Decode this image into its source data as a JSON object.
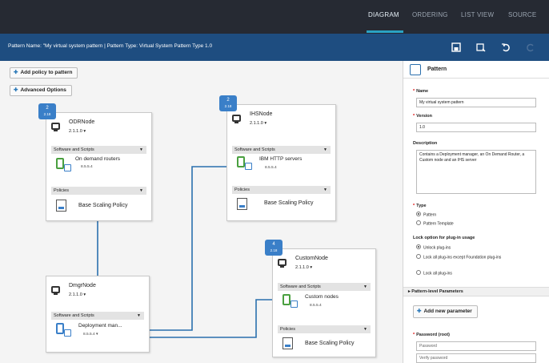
{
  "nav": {
    "tabs": [
      "DIAGRAM",
      "ORDERING",
      "LIST VIEW",
      "SOURCE"
    ],
    "active": "DIAGRAM"
  },
  "subbar": {
    "title": "Pattern Name: \"My virtual system pattern | Pattern Type: Virtual System Pattern Type 1.0",
    "icons": [
      "save-icon",
      "download-icon",
      "undo-icon",
      "redo-icon"
    ]
  },
  "toolbar": {
    "add_policy": "Add policy to pattern",
    "advanced": "Advanced Options"
  },
  "nodes": {
    "odr": {
      "badge": "2",
      "badge_sub": "2.18",
      "name": "ODRNode",
      "version": "2.1.1.0",
      "sw_header": "Software and Scripts",
      "component": "On demand routers",
      "component_ver": "8.5.5.4",
      "pol_header": "Policies",
      "policy": "Base Scaling Policy"
    },
    "ihs": {
      "badge": "2",
      "badge_sub": "2.18",
      "name": "IHSNode",
      "version": "2.1.1.0",
      "sw_header": "Software and Scripts",
      "component": "IBM HTTP servers",
      "component_ver": "8.5.5.4",
      "pol_header": "Policies",
      "policy": "Base Scaling Policy"
    },
    "custom": {
      "badge": "4",
      "badge_sub": "2.18",
      "name": "CustomNode",
      "version": "2.1.1.0",
      "sw_header": "Software and Scripts",
      "component": "Custom nodes",
      "component_ver": "8.5.5.4",
      "pol_header": "Policies",
      "policy": "Base Scaling Policy"
    },
    "dmgr": {
      "name": "DmgrNode",
      "version": "2.1.1.0",
      "sw_header": "Software and Scripts",
      "component": "Deployment man...",
      "component_ver": "8.5.5.4"
    }
  },
  "panel": {
    "title": "Pattern",
    "name_label": "Name",
    "name_value": "My virtual system pattern",
    "version_label": "Version",
    "version_value": "1.0",
    "desc_label": "Description",
    "desc_value": "Contains a Deployment manager, an On Demand Router, a Custom node and an IHS server",
    "type_label": "Type",
    "type_options": [
      "Pattern",
      "Pattern Template"
    ],
    "type_selected": 0,
    "lock_label": "Lock option for plug-in usage",
    "lock_options": [
      "Unlock plug-ins",
      "Lock all plug-ins except Foundation plug-ins",
      "Lock all plug-ins"
    ],
    "lock_selected": 0,
    "params_header": "Pattern-level Parameters",
    "add_param": "Add new parameter",
    "password_label": "Password (root)",
    "password_placeholder": "Password",
    "verify_placeholder": "Verify password"
  },
  "colors": {
    "topbar": "#262a33",
    "subbar": "#1e4d80",
    "accent": "#2aa3c4",
    "badge": "#3a7fc8",
    "link_line": "#2a6fad"
  }
}
